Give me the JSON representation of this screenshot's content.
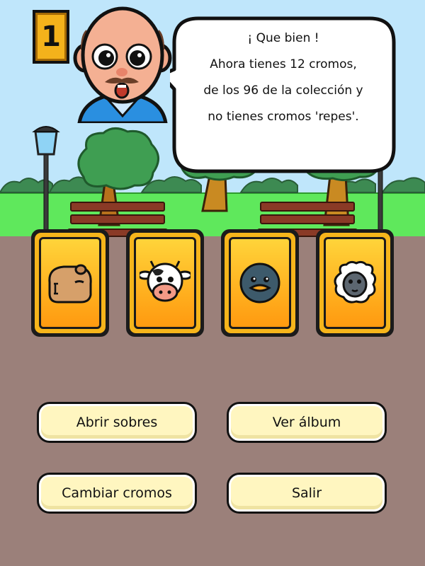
{
  "level": {
    "number": "1"
  },
  "dialog": {
    "lines": [
      "¡ Que bien !",
      "Ahora tienes 12 cromos,",
      "de los 96 de la colección y",
      "no tienes cromos 'repes'."
    ]
  },
  "cards": [
    {
      "icon": "capybara-icon"
    },
    {
      "icon": "cow-icon"
    },
    {
      "icon": "penguin-icon"
    },
    {
      "icon": "sheep-icon"
    }
  ],
  "buttons": {
    "open_packs": "Abrir sobres",
    "view_album": "Ver álbum",
    "trade_cards": "Cambiar cromos",
    "exit": "Salir"
  },
  "colors": {
    "sky": "#bfe6fb",
    "grass": "#5fe85c",
    "ground": "#9b807a",
    "card_gold": "#ffb321",
    "button_fill": "#fff6c0"
  }
}
